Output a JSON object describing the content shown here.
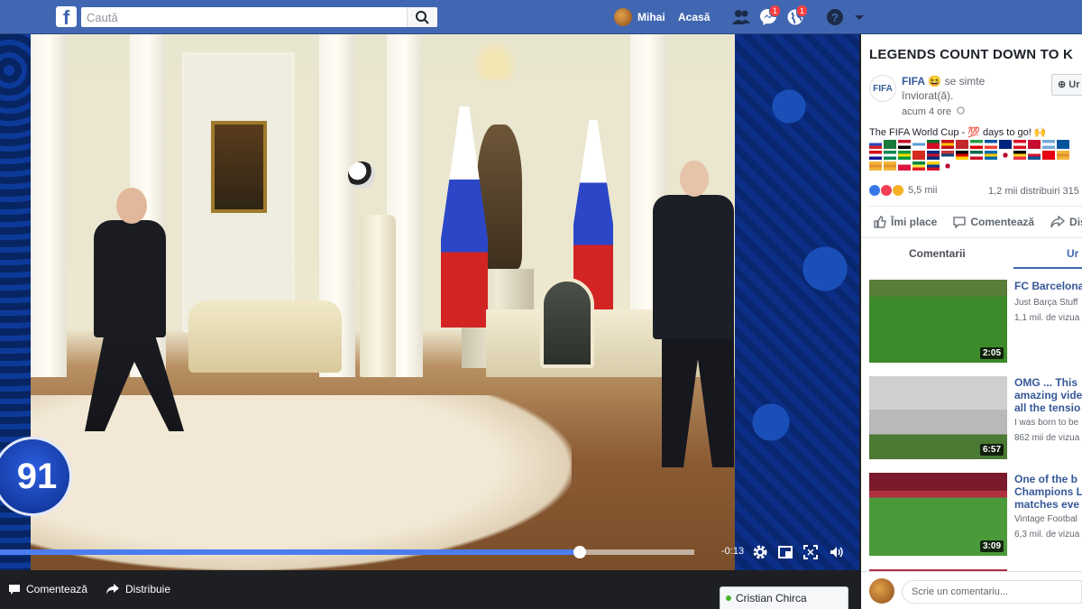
{
  "topbar": {
    "search_placeholder": "Caută",
    "user_name": "Mihai",
    "home_label": "Acasă",
    "messages_count": "1",
    "notifications_count": "1"
  },
  "video": {
    "countdown_number": "91",
    "progress_fraction": 0.835,
    "time_remaining": "-0:13"
  },
  "bottom_bar": {
    "comment_label": "Comentează",
    "share_label": "Distribuie",
    "chat_contact": "Cristian Chirca"
  },
  "post": {
    "title": "LEGENDS COUNT DOWN TO K",
    "author": "FIFA",
    "feeling": "😆 se simte înviorat(ă).",
    "time": "acum 4 ore",
    "follow_label": "Ur",
    "text": "The FIFA World Cup - 💯 days to go! 🙌",
    "reactions_count": "5,5 mii",
    "shares": "1,2 mii distribuiri  315",
    "like_label": "Îmi place",
    "comment_label": "Comentează",
    "share_label": "Dist",
    "tab_comments": "Comentarii",
    "tab_next": "Ur",
    "comment_placeholder": "Scrie un comentariu..."
  },
  "flags": [
    "ru",
    "sa",
    "eg",
    "uy",
    "pt",
    "es",
    "ma",
    "ir",
    "fr",
    "au",
    "pe",
    "dk",
    "ar",
    "is",
    "hr",
    "ng",
    "br",
    "ch",
    "cr",
    "rs",
    "de",
    "mx",
    "se",
    "kr",
    "be",
    "pa",
    "tn",
    "en",
    "en",
    "en",
    "pl",
    "sn",
    "co",
    "jp"
  ],
  "related_videos": [
    {
      "title": "FC Barcelona",
      "source": "Just Barça Stuff",
      "views": "1,1 mil. de vizua",
      "duration": "2:05"
    },
    {
      "title": "OMG ... This amazing vide all the tensio",
      "source": "I was born to be",
      "views": "862 mii de vizua",
      "duration": "6:57"
    },
    {
      "title": "One of the b Champions L matches eve",
      "source": "Vintage Footbal",
      "views": "6,3 mil. de vizua",
      "duration": "3:09"
    }
  ]
}
